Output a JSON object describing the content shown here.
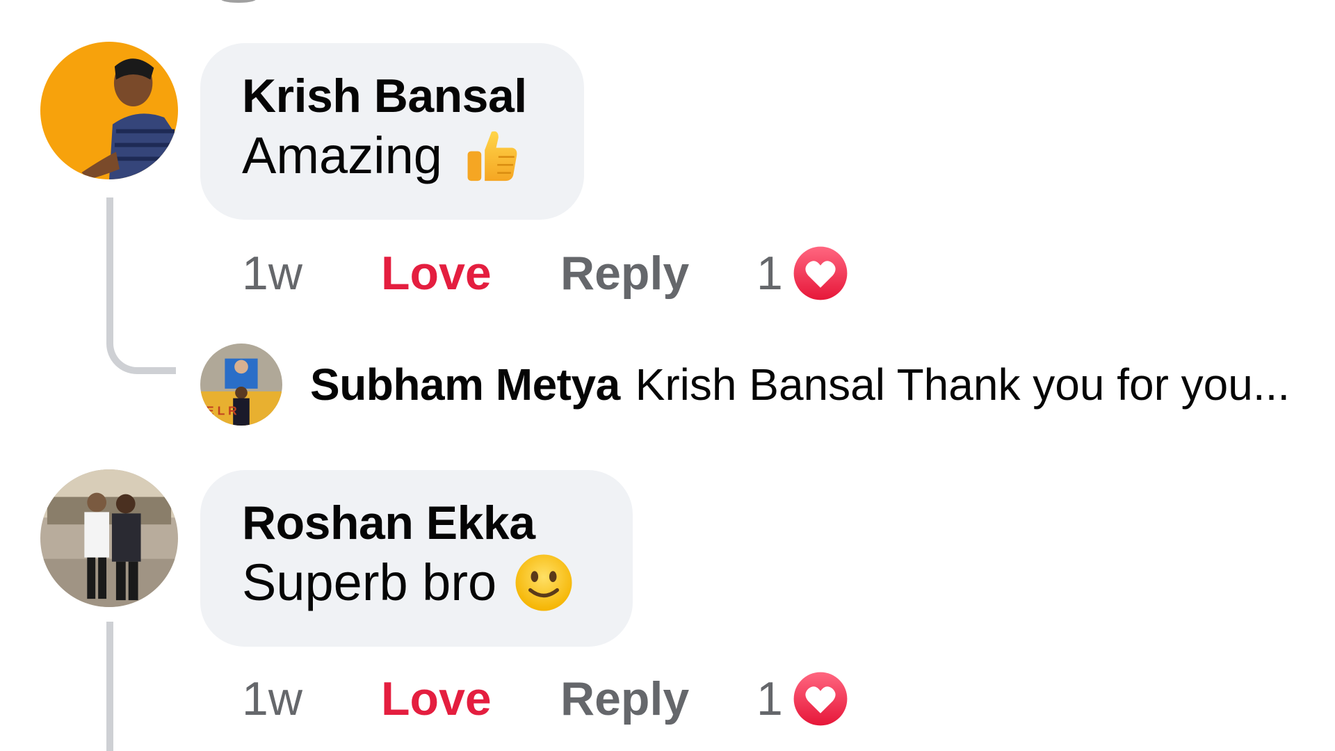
{
  "comments": [
    {
      "author": "Krish Bansal",
      "text": "Amazing",
      "emoji": "thumbs-up",
      "time": "1w",
      "reaction_label": "Love",
      "reply_label": "Reply",
      "reaction_count": "1",
      "avatar_color": "#f7a20c",
      "reply_preview": {
        "author": "Subham Metya",
        "text": "Krish Bansal Thank you for you..."
      }
    },
    {
      "author": "Roshan Ekka",
      "text": "Superb bro",
      "emoji": "smiling-face",
      "time": "1w",
      "reaction_label": "Love",
      "reply_label": "Reply",
      "reaction_count": "1",
      "avatar_color": "#a89a8a"
    }
  ],
  "colors": {
    "bubble": "#f0f2f5",
    "love": "#e41e3f",
    "secondary_text": "#65676b",
    "heart_gradient_top": "#ff6680",
    "heart_gradient_bottom": "#e61739",
    "thread_line": "#ced0d4"
  }
}
